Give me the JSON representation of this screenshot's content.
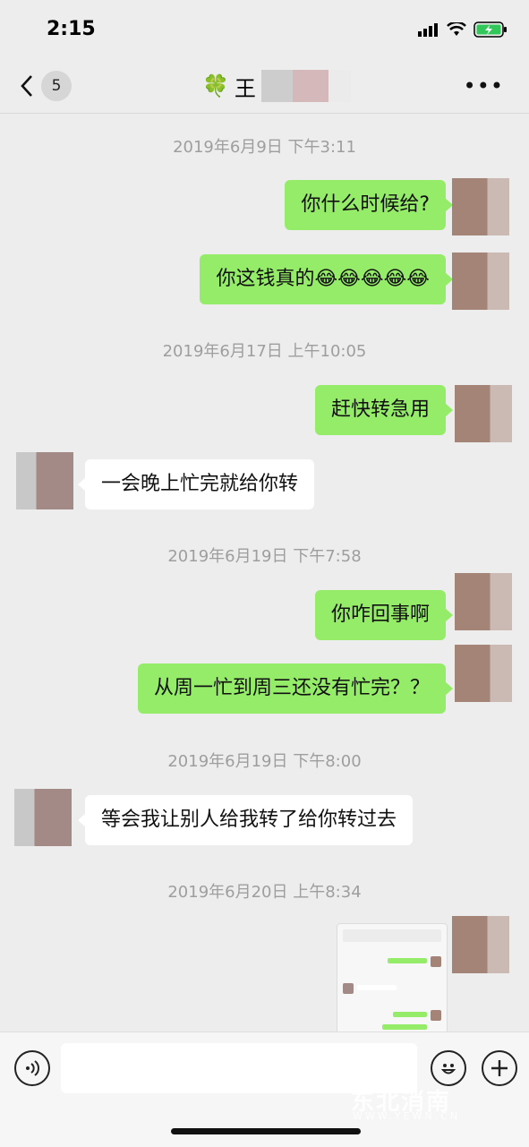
{
  "status": {
    "time": "2:15"
  },
  "nav": {
    "back_count": "5",
    "contact_icon": "🍀",
    "contact_name": "王",
    "more_label": "•••"
  },
  "messages": [
    {
      "timestamp": "2019年6月9日 下午3:11"
    },
    {
      "from": "me",
      "text": "你什么时候给?"
    },
    {
      "from": "me",
      "text": "你这钱真的😂😂😂😂😂"
    },
    {
      "timestamp": "2019年6月17日 上午10:05"
    },
    {
      "from": "me",
      "text": "赶快转急用"
    },
    {
      "from": "other",
      "text": "一会晚上忙完就给你转"
    },
    {
      "timestamp": "2019年6月19日 下午7:58"
    },
    {
      "from": "me",
      "text": "你咋回事啊"
    },
    {
      "from": "me",
      "text": "从周一忙到周三还没有忙完？？"
    },
    {
      "timestamp": "2019年6月19日 下午8:00"
    },
    {
      "from": "other",
      "text": "等会我让别人给我转了给你转过去"
    },
    {
      "timestamp": "2019年6月20日 上午8:34"
    },
    {
      "from": "me",
      "type": "image"
    }
  ],
  "input": {
    "voice_icon": "voice-icon",
    "emoji_icon": "emoji-icon",
    "plus_icon": "plus-icon"
  },
  "watermark": {
    "text": "东北消南",
    "sub": "WWW.YEWN.CN"
  }
}
